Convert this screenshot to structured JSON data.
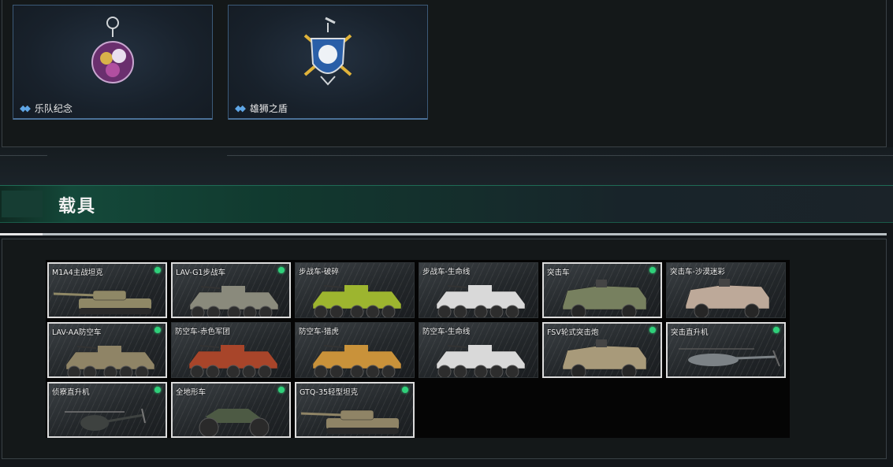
{
  "charms": [
    {
      "name": "乐队纪念",
      "icon": "band-charm-icon"
    },
    {
      "name": "雄狮之盾",
      "icon": "lion-shield-charm-icon"
    }
  ],
  "section": {
    "title": "载具"
  },
  "vehicles": [
    {
      "name": "M1A4主战坦克",
      "owned": true,
      "kind": "tank",
      "camo": "#8f8866"
    },
    {
      "name": "LAV-G1步战车",
      "owned": true,
      "kind": "apc",
      "camo": "#8a8a7c"
    },
    {
      "name": "步战车-破碎",
      "owned": false,
      "kind": "apc",
      "camo": "#9db52f"
    },
    {
      "name": "步战车-生命线",
      "owned": false,
      "kind": "apc",
      "camo": "#d9d9d9"
    },
    {
      "name": "突击车",
      "owned": true,
      "kind": "truck",
      "camo": "#77805f"
    },
    {
      "name": "突击车-沙漠迷彩",
      "owned": false,
      "kind": "truck",
      "camo": "#bda999"
    },
    {
      "name": "LAV-AA防空车",
      "owned": true,
      "kind": "apc",
      "camo": "#8f8466"
    },
    {
      "name": "防空车-赤色军团",
      "owned": false,
      "kind": "apc",
      "camo": "#a8452a"
    },
    {
      "name": "防空车-猎虎",
      "owned": false,
      "kind": "apc",
      "camo": "#c9923a"
    },
    {
      "name": "防空车-生命线",
      "owned": false,
      "kind": "apc",
      "camo": "#d9d9d9"
    },
    {
      "name": "FSV轮式突击炮",
      "owned": true,
      "kind": "truck",
      "camo": "#a89a7a"
    },
    {
      "name": "突击直升机",
      "owned": true,
      "kind": "heli",
      "camo": "#7c8286"
    },
    {
      "name": "侦察直升机",
      "owned": true,
      "kind": "scout",
      "camo": "#3e4240"
    },
    {
      "name": "全地形车",
      "owned": true,
      "kind": "atv",
      "camo": "#4d5a44"
    },
    {
      "name": "GTQ-35轻型坦克",
      "owned": true,
      "kind": "tank",
      "camo": "#8f8466"
    }
  ]
}
